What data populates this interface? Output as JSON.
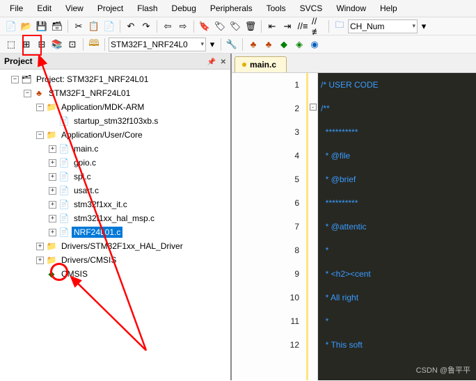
{
  "menubar": [
    "File",
    "Edit",
    "View",
    "Project",
    "Flash",
    "Debug",
    "Peripherals",
    "Tools",
    "SVCS",
    "Window",
    "Help"
  ],
  "toolbar1_combo": "CH_Num",
  "toolbar2_target": "STM32F1_NRF24L0",
  "panel": {
    "title": "Project"
  },
  "tree": {
    "root": "Project: STM32F1_NRF24L01",
    "target": "STM32F1_NRF24L01",
    "g_mdkarm": "Application/MDK-ARM",
    "f_startup": "startup_stm32f103xb.s",
    "g_usercore": "Application/User/Core",
    "f_main": "main.c",
    "f_gpio": "gpio.c",
    "f_spi": "spi.c",
    "f_usart": "usart.c",
    "f_it": "stm32f1xx_it.c",
    "f_halmsp": "stm32f1xx_hal_msp.c",
    "f_nrf": "NRF24L01.c",
    "g_haldrv": "Drivers/STM32F1xx_HAL_Driver",
    "g_cmsisdrv": "Drivers/CMSIS",
    "g_cmsis": "CMSIS"
  },
  "tab": {
    "filename": "main.c"
  },
  "code": {
    "l1": "/* USER CODE ",
    "l2": "/**",
    "l3": "  **********",
    "l4": "  * @file   ",
    "l5": "  * @brief  ",
    "l6": "  **********",
    "l7": "  * @attentic",
    "l8": "  *",
    "l9": "  * <h2><cent",
    "l10": "  * All right",
    "l11": "  *",
    "l12": "  * This soft"
  },
  "watermark": "CSDN @鲁平平"
}
